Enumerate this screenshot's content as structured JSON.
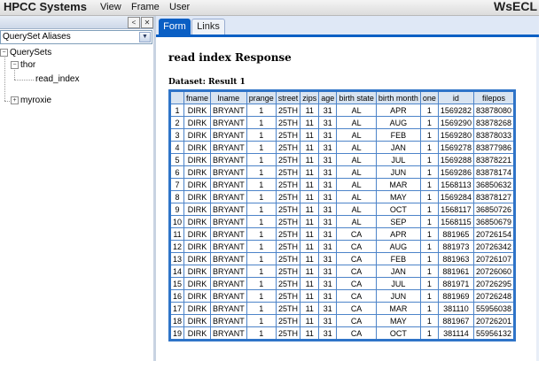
{
  "app": {
    "brand": "HPCC Systems",
    "menu": [
      "View",
      "Frame",
      "User"
    ],
    "brand_right": "WsECL"
  },
  "sidebar": {
    "collapse_glyph": "<",
    "close_glyph": "✕",
    "select_value": "QuerySet Aliases",
    "tree": {
      "root": "QuerySets",
      "thor": "thor",
      "read_index": "read_index",
      "myroxie": "myroxie"
    }
  },
  "tabs": [
    "Form",
    "Links"
  ],
  "response": {
    "title": "read index Response",
    "dataset_label": "Dataset: Result 1",
    "columns": [
      "",
      "fname",
      "lname",
      "prange",
      "street",
      "zips",
      "age",
      "birth state",
      "birth month",
      "one",
      "id",
      "filepos"
    ],
    "rows": [
      [
        "1",
        "DIRK",
        "BRYANT",
        "1",
        "25TH",
        "11",
        "31",
        "AL",
        "APR",
        "1",
        "1569282",
        "83878080"
      ],
      [
        "2",
        "DIRK",
        "BRYANT",
        "1",
        "25TH",
        "11",
        "31",
        "AL",
        "AUG",
        "1",
        "1569290",
        "83878268"
      ],
      [
        "3",
        "DIRK",
        "BRYANT",
        "1",
        "25TH",
        "11",
        "31",
        "AL",
        "FEB",
        "1",
        "1569280",
        "83878033"
      ],
      [
        "4",
        "DIRK",
        "BRYANT",
        "1",
        "25TH",
        "11",
        "31",
        "AL",
        "JAN",
        "1",
        "1569278",
        "83877986"
      ],
      [
        "5",
        "DIRK",
        "BRYANT",
        "1",
        "25TH",
        "11",
        "31",
        "AL",
        "JUL",
        "1",
        "1569288",
        "83878221"
      ],
      [
        "6",
        "DIRK",
        "BRYANT",
        "1",
        "25TH",
        "11",
        "31",
        "AL",
        "JUN",
        "1",
        "1569286",
        "83878174"
      ],
      [
        "7",
        "DIRK",
        "BRYANT",
        "1",
        "25TH",
        "11",
        "31",
        "AL",
        "MAR",
        "1",
        "1568113",
        "36850632"
      ],
      [
        "8",
        "DIRK",
        "BRYANT",
        "1",
        "25TH",
        "11",
        "31",
        "AL",
        "MAY",
        "1",
        "1569284",
        "83878127"
      ],
      [
        "9",
        "DIRK",
        "BRYANT",
        "1",
        "25TH",
        "11",
        "31",
        "AL",
        "OCT",
        "1",
        "1568117",
        "36850726"
      ],
      [
        "10",
        "DIRK",
        "BRYANT",
        "1",
        "25TH",
        "11",
        "31",
        "AL",
        "SEP",
        "1",
        "1568115",
        "36850679"
      ],
      [
        "11",
        "DIRK",
        "BRYANT",
        "1",
        "25TH",
        "11",
        "31",
        "CA",
        "APR",
        "1",
        "881965",
        "20726154"
      ],
      [
        "12",
        "DIRK",
        "BRYANT",
        "1",
        "25TH",
        "11",
        "31",
        "CA",
        "AUG",
        "1",
        "881973",
        "20726342"
      ],
      [
        "13",
        "DIRK",
        "BRYANT",
        "1",
        "25TH",
        "11",
        "31",
        "CA",
        "FEB",
        "1",
        "881963",
        "20726107"
      ],
      [
        "14",
        "DIRK",
        "BRYANT",
        "1",
        "25TH",
        "11",
        "31",
        "CA",
        "JAN",
        "1",
        "881961",
        "20726060"
      ],
      [
        "15",
        "DIRK",
        "BRYANT",
        "1",
        "25TH",
        "11",
        "31",
        "CA",
        "JUL",
        "1",
        "881971",
        "20726295"
      ],
      [
        "16",
        "DIRK",
        "BRYANT",
        "1",
        "25TH",
        "11",
        "31",
        "CA",
        "JUN",
        "1",
        "881969",
        "20726248"
      ],
      [
        "17",
        "DIRK",
        "BRYANT",
        "1",
        "25TH",
        "11",
        "31",
        "CA",
        "MAR",
        "1",
        "381110",
        "55956038"
      ],
      [
        "18",
        "DIRK",
        "BRYANT",
        "1",
        "25TH",
        "11",
        "31",
        "CA",
        "MAY",
        "1",
        "881967",
        "20726201"
      ],
      [
        "19",
        "DIRK",
        "BRYANT",
        "1",
        "25TH",
        "11",
        "31",
        "CA",
        "OCT",
        "1",
        "381114",
        "55956132"
      ]
    ]
  }
}
